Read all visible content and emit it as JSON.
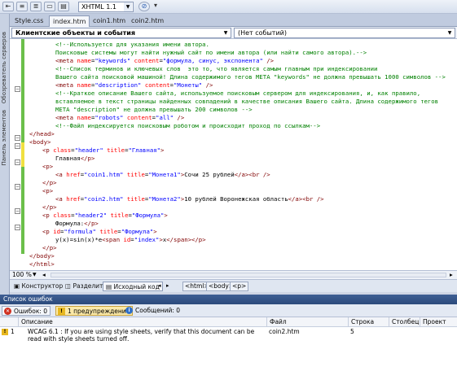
{
  "toolbar": {
    "doctype": "XHTML 1.1"
  },
  "left_strip": {
    "items": [
      "Обозреватель серверов",
      "Панель элементов"
    ]
  },
  "tabs": [
    "Style.css",
    "index.htm",
    "coin1.htm",
    "coin2.htm"
  ],
  "combos": {
    "left": "Клиентские объекты и события",
    "right": "(Нет событий)"
  },
  "editor": {
    "zoom": "100 %"
  },
  "viewbar": {
    "buttons": [
      "Конструктор",
      "Разделить",
      "Исходный код"
    ],
    "breadcrumbs": [
      "<html>",
      "<body>",
      "<p>"
    ]
  },
  "error_list": {
    "title": "Список ошибок",
    "filters": [
      "Ошибок: 0",
      "1 предупреждение",
      "Сообщений: 0"
    ],
    "columns": [
      "Описание",
      "Файл",
      "Строка",
      "Столбец",
      "Проект"
    ],
    "rows": [
      {
        "num": "1",
        "description": "WCAG 6.1 : If you are using style sheets, verify that this document can be read with style sheets turned off.",
        "file": "coin2.htm",
        "line": "5",
        "column": "",
        "project": ""
      }
    ]
  },
  "code_lines": [
    [
      [
        "c",
        "<!--Используется для указания имени автора."
      ]
    ],
    [
      [
        "c",
        "Поисковые системы могут найти нужный сайт по имени автора (или найти самого автора).-->"
      ]
    ],
    [
      [
        "t",
        "<meta "
      ],
      [
        "a",
        "name"
      ],
      [
        "x",
        "="
      ],
      [
        "v",
        "\"keywords\""
      ],
      [
        "a",
        " content"
      ],
      [
        "x",
        "="
      ],
      [
        "v",
        "\"формула, синус, экспонента\""
      ],
      [
        "t",
        " />"
      ]
    ],
    [
      [
        "c",
        "<!--Список терминов и ключевых слов  это то, что является самым главным при индексировании"
      ]
    ],
    [
      [
        "c",
        "Вашего сайта поисковой машиной! Длина содержимого тегов META \"keywords\" не должна превышать 1000 символов -->"
      ]
    ],
    [
      [
        "t",
        "<meta "
      ],
      [
        "a",
        "name"
      ],
      [
        "x",
        "="
      ],
      [
        "v",
        "\"description\""
      ],
      [
        "a",
        " content"
      ],
      [
        "x",
        "="
      ],
      [
        "v",
        "\"Монеты\""
      ],
      [
        "t",
        " />"
      ]
    ],
    [
      [
        "c",
        "<!--Краткое описание Вашего сайта, используемое поисковым сервером для индексирования, и, как правило,"
      ]
    ],
    [
      [
        "c",
        "вставляемое в текст страницы найденных совпадений в качестве описания Вашего сайта. Длина содержимого тегов"
      ]
    ],
    [
      [
        "c",
        "META \"description\" не должна превышать 200 символов -->"
      ]
    ],
    [
      [
        "t",
        "<meta "
      ],
      [
        "a",
        "name"
      ],
      [
        "x",
        "="
      ],
      [
        "v",
        "\"robots\""
      ],
      [
        "a",
        " content"
      ],
      [
        "x",
        "="
      ],
      [
        "v",
        "\"all\""
      ],
      [
        "t",
        " />"
      ]
    ],
    [
      [
        "c",
        "<!--Файл индексируется поисковым роботом и происходит проход по ссылкам-->"
      ]
    ],
    [
      [
        "t",
        "</head>"
      ]
    ],
    [
      [
        "t",
        "<body>"
      ]
    ],
    [
      [
        "t",
        "<p "
      ],
      [
        "a",
        "class"
      ],
      [
        "x",
        "="
      ],
      [
        "v",
        "\"header\""
      ],
      [
        "a",
        " title"
      ],
      [
        "x",
        "="
      ],
      [
        "v",
        "\"Главная\""
      ],
      [
        "t",
        ">"
      ]
    ],
    [
      [
        "x",
        "Главная"
      ],
      [
        "t",
        "</p>"
      ]
    ],
    [
      [
        "t",
        "<p>"
      ]
    ],
    [
      [
        "t",
        "<a "
      ],
      [
        "a",
        "href"
      ],
      [
        "x",
        "="
      ],
      [
        "v",
        "\"coin1.htm\""
      ],
      [
        "a",
        " title"
      ],
      [
        "x",
        "="
      ],
      [
        "v",
        "\"Монета1\""
      ],
      [
        "t",
        ">"
      ],
      [
        "x",
        "Сочи 25 рублей"
      ],
      [
        "t",
        "</a><br />"
      ]
    ],
    [
      [
        "t",
        "</p>"
      ]
    ],
    [
      [
        "t",
        "<p>"
      ]
    ],
    [
      [
        "t",
        "<a "
      ],
      [
        "a",
        "href"
      ],
      [
        "x",
        "="
      ],
      [
        "v",
        "\"coin2.htm\""
      ],
      [
        "a",
        " title"
      ],
      [
        "x",
        "="
      ],
      [
        "v",
        "\"Монета2\""
      ],
      [
        "t",
        ">"
      ],
      [
        "x",
        "10 рублей Воронежская область"
      ],
      [
        "t",
        "</a><br />"
      ]
    ],
    [
      [
        "t",
        "</p>"
      ]
    ],
    [
      [
        "t",
        "<p "
      ],
      [
        "a",
        "class"
      ],
      [
        "x",
        "="
      ],
      [
        "v",
        "\"header2\""
      ],
      [
        "a",
        " title"
      ],
      [
        "x",
        "="
      ],
      [
        "v",
        "\"Формула\""
      ],
      [
        "t",
        ">"
      ]
    ],
    [
      [
        "x",
        "Формула:"
      ],
      [
        "t",
        "</p>"
      ]
    ],
    [
      [
        "t",
        "<p "
      ],
      [
        "a",
        "id"
      ],
      [
        "x",
        "="
      ],
      [
        "v",
        "\"formula\""
      ],
      [
        "a",
        " title"
      ],
      [
        "x",
        "="
      ],
      [
        "v",
        "\"Формула\""
      ],
      [
        "t",
        ">"
      ]
    ],
    [
      [
        "x",
        "y(x)=sin(x)*e"
      ],
      [
        "t",
        "<span "
      ],
      [
        "a",
        "id"
      ],
      [
        "x",
        "="
      ],
      [
        "v",
        "\"index\""
      ],
      [
        "t",
        ">"
      ],
      [
        "x",
        "x"
      ],
      [
        "t",
        "</span></p>"
      ]
    ],
    [
      [
        "t",
        "</p>"
      ]
    ],
    [
      [
        "t",
        "</body>"
      ]
    ],
    [
      [
        "t",
        "</html>"
      ]
    ]
  ]
}
